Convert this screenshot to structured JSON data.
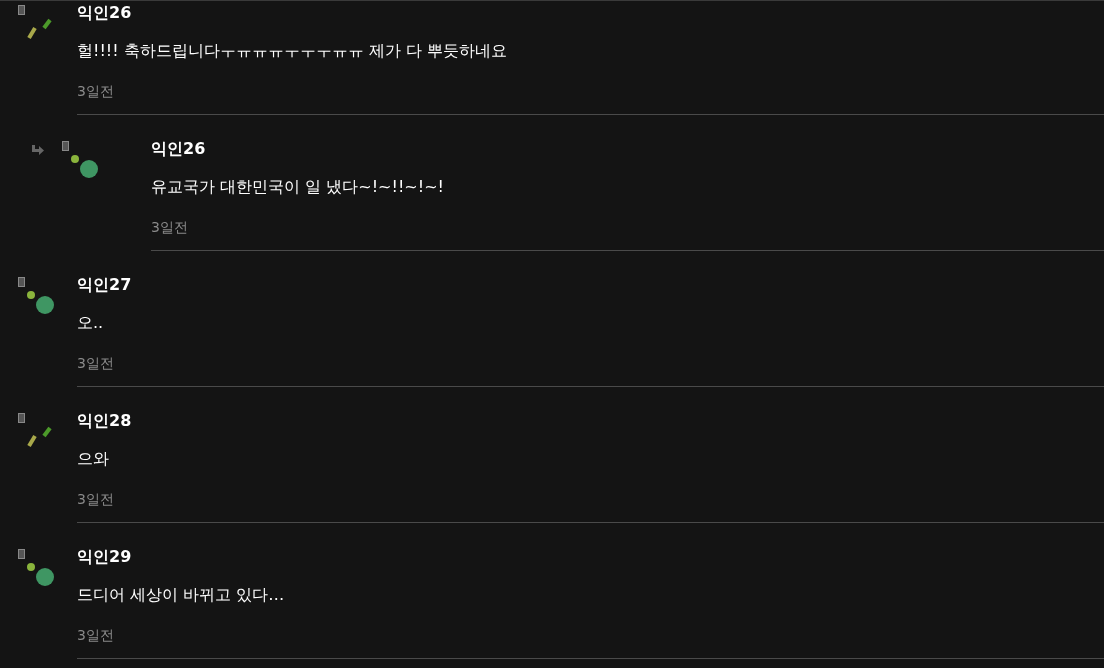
{
  "comments": [
    {
      "author": "익인26",
      "avatar": {
        "kind": "sticks"
      },
      "text": "헐!!!! 축하드립니다ㅜㅠㅠㅠㅜㅜㅜㅠㅠ 제가 다 뿌듯하네요",
      "time": "3일전",
      "replies": [
        {
          "author": "익인26",
          "avatar": {
            "kind": "dots"
          },
          "text": "유교국가 대한민국이 일 냈다~!~!!~!~!",
          "time": "3일전"
        }
      ]
    },
    {
      "author": "익인27",
      "avatar": {
        "kind": "dots"
      },
      "text": "오..",
      "time": "3일전"
    },
    {
      "author": "익인28",
      "avatar": {
        "kind": "sticks"
      },
      "text": "으와",
      "time": "3일전"
    },
    {
      "author": "익인29",
      "avatar": {
        "kind": "dots"
      },
      "text": "드디어 세상이 바뀌고 있다…",
      "time": "3일전"
    }
  ]
}
